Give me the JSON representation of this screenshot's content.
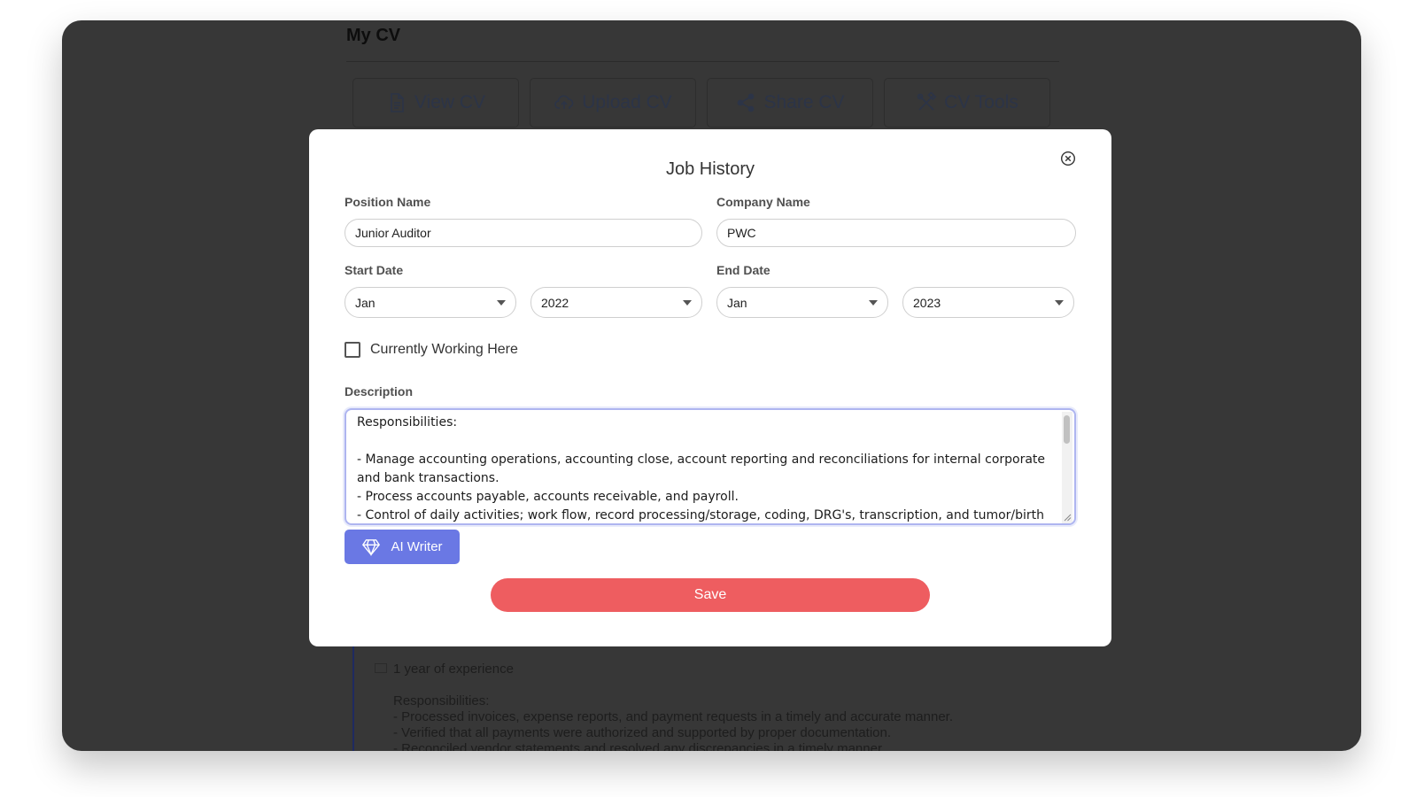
{
  "page": {
    "title": "My CV"
  },
  "cv_tabs": [
    {
      "label": "View CV",
      "icon": "document-icon"
    },
    {
      "label": "Upload CV",
      "icon": "cloud-upload-icon"
    },
    {
      "label": "Share CV",
      "icon": "share-icon"
    },
    {
      "label": "CV Tools",
      "icon": "tools-icon"
    }
  ],
  "background_entry": {
    "experience": "1 year of experience",
    "description": "Responsibilities:\n- Processed invoices, expense reports, and payment requests in a timely and accurate manner.\n- Verified that all payments were authorized and supported by proper documentation.\n- Reconciled vendor statements and resolved any discrepancies in a timely manner."
  },
  "modal": {
    "title": "Job History",
    "position_label": "Position Name",
    "position_value": "Junior Auditor",
    "company_label": "Company Name",
    "company_value": "PWC",
    "start_label": "Start Date",
    "start_month": "Jan",
    "start_year": "2022",
    "end_label": "End Date",
    "end_month": "Jan",
    "end_year": "2023",
    "currently_working_label": "Currently Working Here",
    "currently_working_checked": false,
    "description_label": "Description",
    "description_value": "Responsibilities:\n\n- Manage accounting operations, accounting close, account reporting and reconciliations for internal corporate and bank transactions.\n- Process accounts payable, accounts receivable, and payroll.\n- Control of daily activities; work flow, record processing/storage, coding, DRG's, transcription, and tumor/birth",
    "ai_writer_label": "AI Writer",
    "save_label": "Save"
  },
  "colors": {
    "overlay": "#373737",
    "accent": "#6a78e4",
    "save": "#ee5d60",
    "focus_border": "#aeb5f0"
  }
}
